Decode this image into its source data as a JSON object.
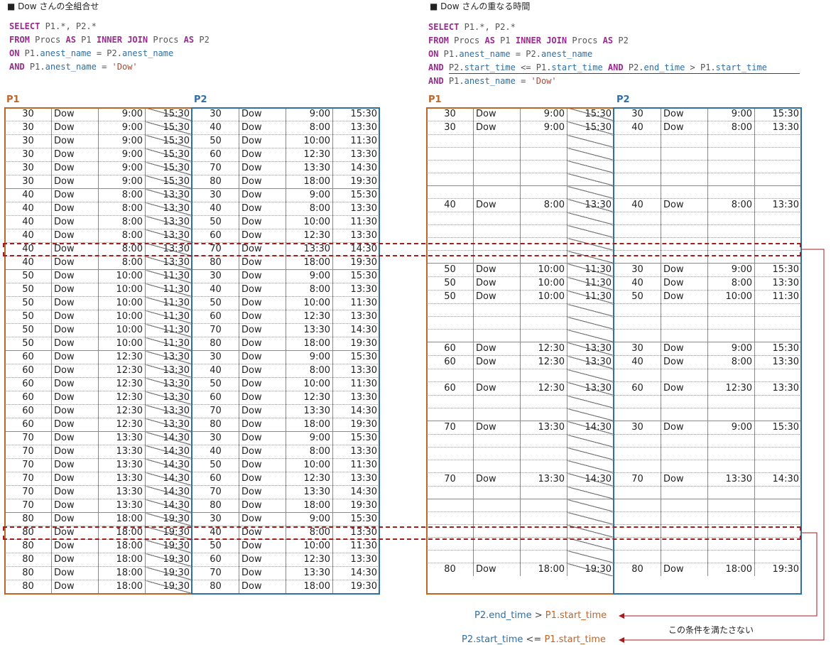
{
  "left": {
    "title": "■ Dow さんの全組合せ",
    "sql": [
      [
        [
          "kw",
          "SELECT"
        ],
        [
          "t",
          " P1.*, P2.*"
        ]
      ],
      [
        [
          "kw",
          "FROM"
        ],
        [
          "t",
          " Procs "
        ],
        [
          "kw",
          "AS"
        ],
        [
          "t",
          " P1 "
        ],
        [
          "kw",
          "INNER JOIN"
        ],
        [
          "t",
          " Procs "
        ],
        [
          "kw",
          "AS"
        ],
        [
          "t",
          " P2"
        ]
      ],
      [
        [
          "kw",
          "ON"
        ],
        [
          "t",
          " P1."
        ],
        [
          "id",
          "anest_name"
        ],
        [
          "t",
          " = P2."
        ],
        [
          "id",
          "anest_name"
        ]
      ],
      [
        [
          "kw",
          "AND"
        ],
        [
          "t",
          " P1."
        ],
        [
          "id",
          "anest_name"
        ],
        [
          "t",
          " = "
        ],
        [
          "str",
          "'Dow'"
        ]
      ]
    ],
    "p1_label": "P1",
    "p2_label": "P2"
  },
  "right": {
    "title": "■ Dow さんの重なる時間",
    "sql": [
      [
        [
          "kw",
          "SELECT"
        ],
        [
          "t",
          " P1.*, P2.*"
        ]
      ],
      [
        [
          "kw",
          "FROM"
        ],
        [
          "t",
          " Procs "
        ],
        [
          "kw",
          "AS"
        ],
        [
          "t",
          " P1 "
        ],
        [
          "kw",
          "INNER JOIN"
        ],
        [
          "t",
          " Procs "
        ],
        [
          "kw",
          "AS"
        ],
        [
          "t",
          " P2"
        ]
      ],
      [
        [
          "kw",
          "ON"
        ],
        [
          "t",
          " P1."
        ],
        [
          "id",
          "anest_name"
        ],
        [
          "t",
          " = P2."
        ],
        [
          "id",
          "anest_name"
        ]
      ],
      [
        [
          "kw",
          "AND"
        ],
        [
          "t",
          " P2."
        ],
        [
          "id",
          "start_time"
        ],
        [
          "t",
          " <= P1."
        ],
        [
          "id",
          "start_time"
        ],
        [
          "t",
          " "
        ],
        [
          "kw",
          "AND"
        ],
        [
          "t",
          " P2."
        ],
        [
          "id",
          "end_time"
        ],
        [
          "t",
          " > P1."
        ],
        [
          "id",
          "start_time"
        ]
      ],
      [
        [
          "kw",
          "AND"
        ],
        [
          "t",
          " P1."
        ],
        [
          "id",
          "anest_name"
        ],
        [
          "t",
          " = "
        ],
        [
          "str",
          "'Dow'"
        ]
      ]
    ],
    "p1_label": "P1",
    "p2_label": "P2"
  },
  "procs": [
    {
      "id": "30",
      "name": "Dow",
      "start": "9:00",
      "end": "15:30"
    },
    {
      "id": "40",
      "name": "Dow",
      "start": "8:00",
      "end": "13:30"
    },
    {
      "id": "50",
      "name": "Dow",
      "start": "10:00",
      "end": "11:30"
    },
    {
      "id": "60",
      "name": "Dow",
      "start": "12:30",
      "end": "13:30"
    },
    {
      "id": "70",
      "name": "Dow",
      "start": "13:30",
      "end": "14:30"
    },
    {
      "id": "80",
      "name": "Dow",
      "start": "18:00",
      "end": "19:30"
    }
  ],
  "annotations": {
    "cond_end": {
      "p2": "P2.end_time",
      "op": " > ",
      "p1": "P1.start_time"
    },
    "cond_start": {
      "p2": "P2.start_time",
      "op": " <= ",
      "p1": "P1.start_time"
    },
    "note": "この条件を満たさない"
  }
}
